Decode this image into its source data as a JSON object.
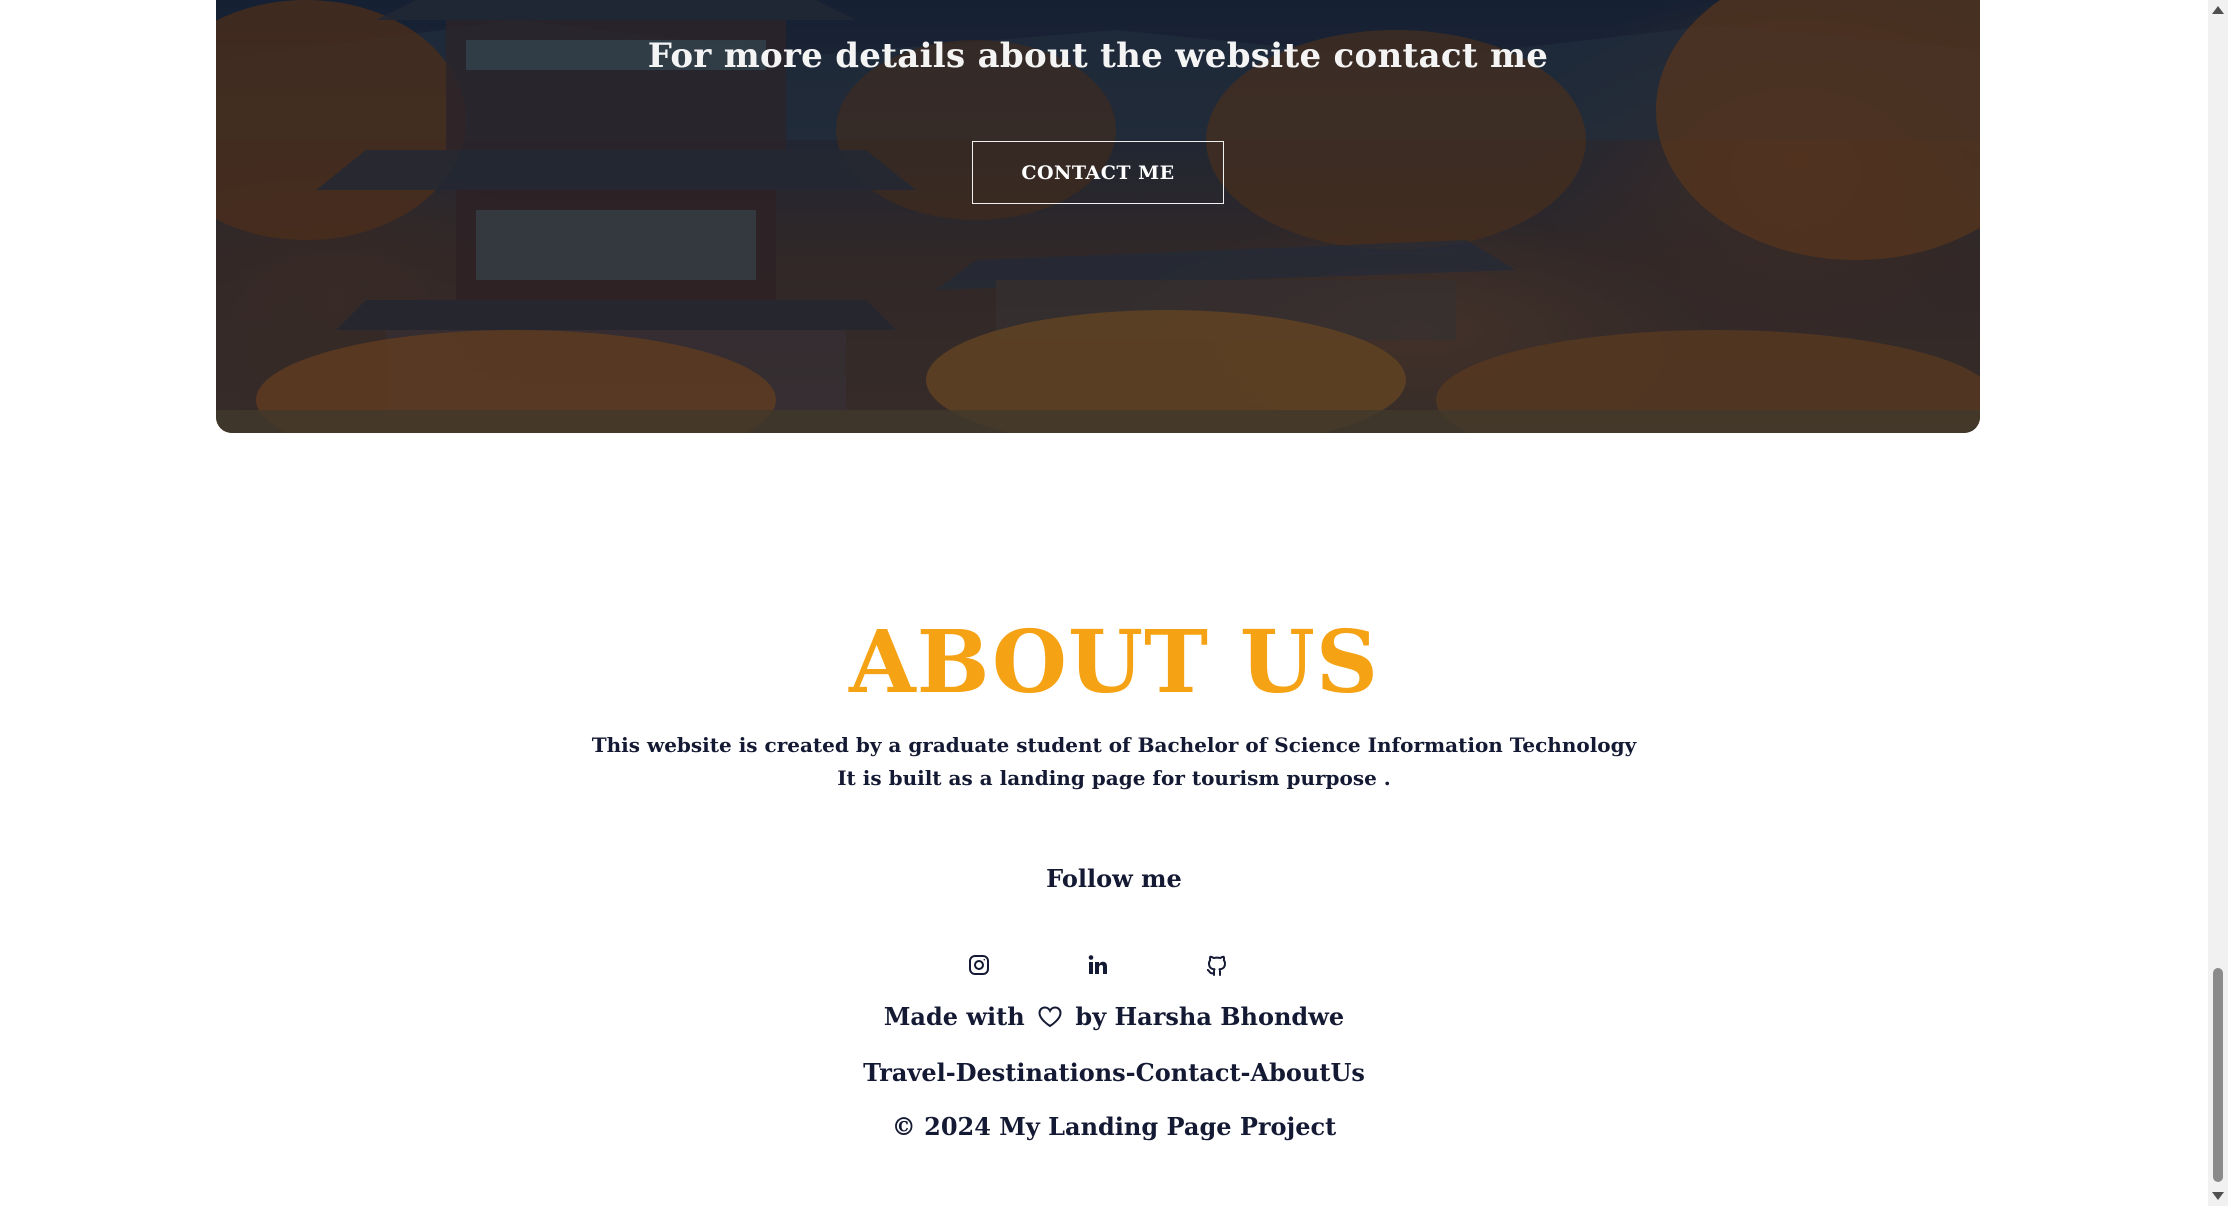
{
  "banner": {
    "title": "For more details about the website contact me",
    "button_label": "CONTACT ME"
  },
  "about": {
    "title": "ABOUT US",
    "line1": "This website is created by a graduate student of Bachelor of Science Information Technology",
    "line2": "It is built as a landing page for tourism purpose ."
  },
  "footer": {
    "follow": "Follow me",
    "socials": [
      {
        "name": "instagram-icon"
      },
      {
        "name": "linkedin-icon"
      },
      {
        "name": "github-icon"
      }
    ],
    "made_prefix": "Made with",
    "made_suffix": "by Harsha Bhondwe",
    "links": [
      "Travel",
      "Destinations",
      "Contact",
      "AboutUs"
    ],
    "separator": "-",
    "copyright": "© 2024 My Landing Page Project"
  },
  "colors": {
    "accent": "#f5a214",
    "text": "#141a33"
  }
}
